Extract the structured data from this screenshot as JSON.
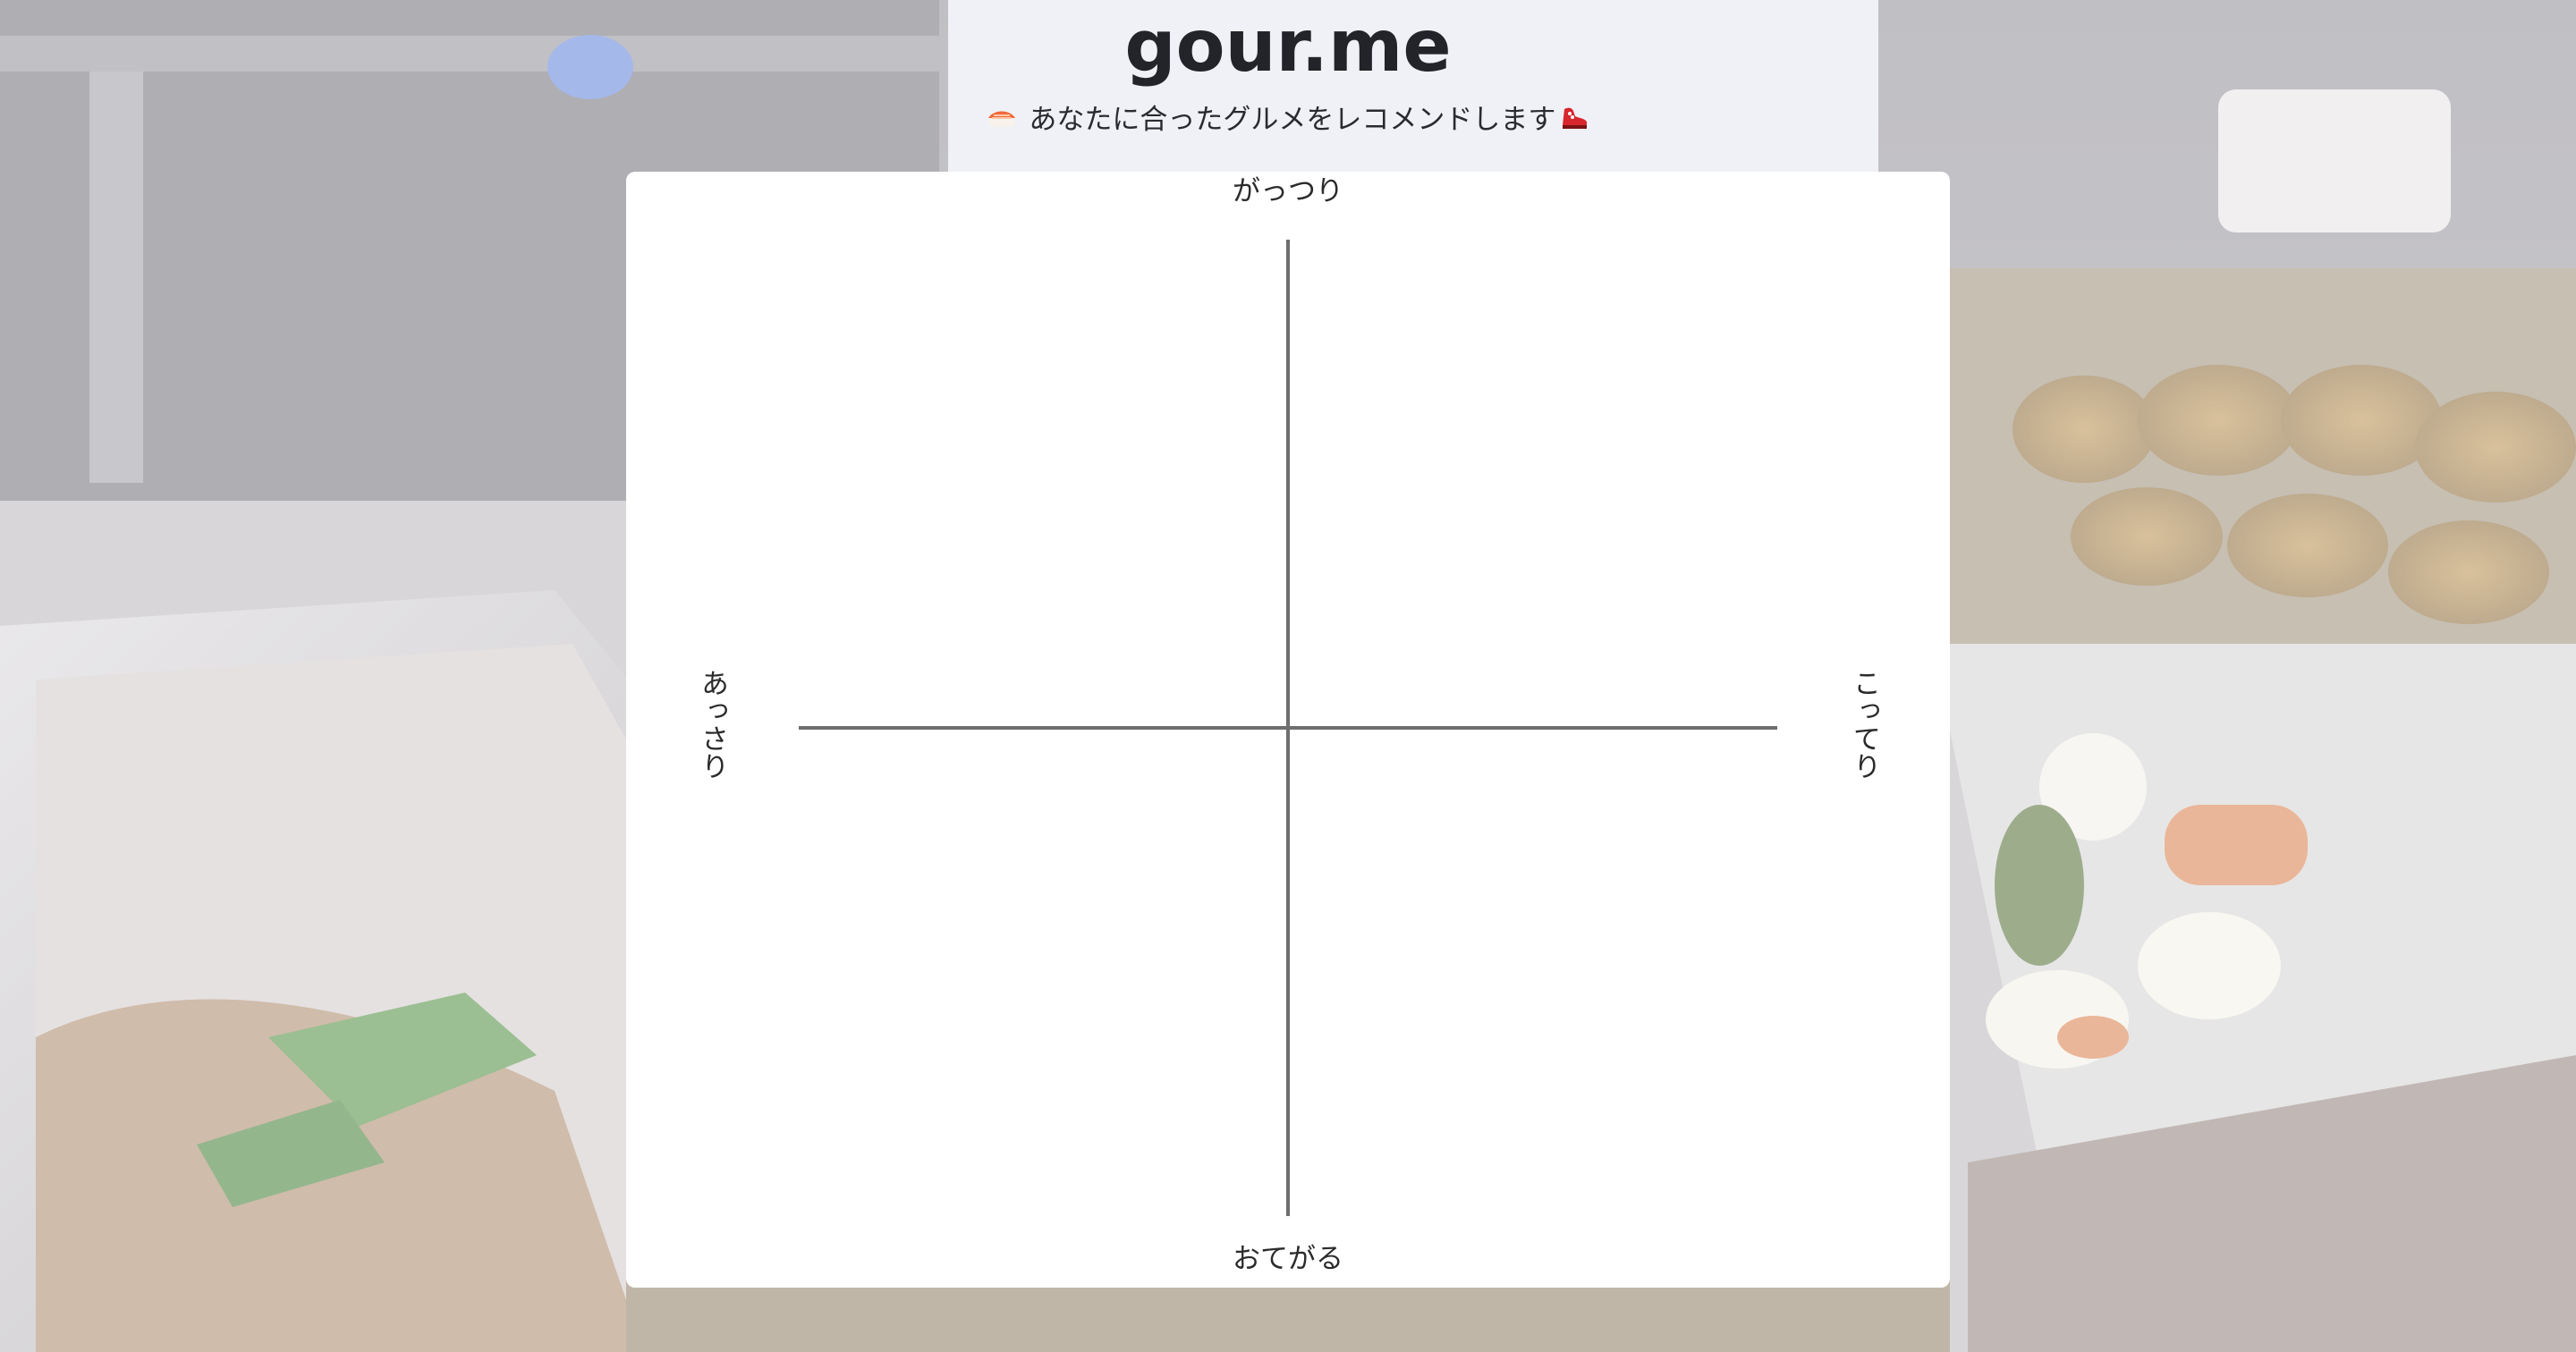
{
  "header": {
    "title": "gour.me",
    "subtitle_text": " あなたに合ったグルメをレコメンドします",
    "subtitle_left_icon": "sushi-icon",
    "subtitle_right_icon": "shoe-icon"
  },
  "quadrant": {
    "top_label": "がっつり",
    "bottom_label": "おてがる",
    "left_label": "あっさり",
    "right_label": "こってり"
  },
  "colors": {
    "card": "#ffffff",
    "axis": "#6e6e6e",
    "title": "#23232a"
  }
}
